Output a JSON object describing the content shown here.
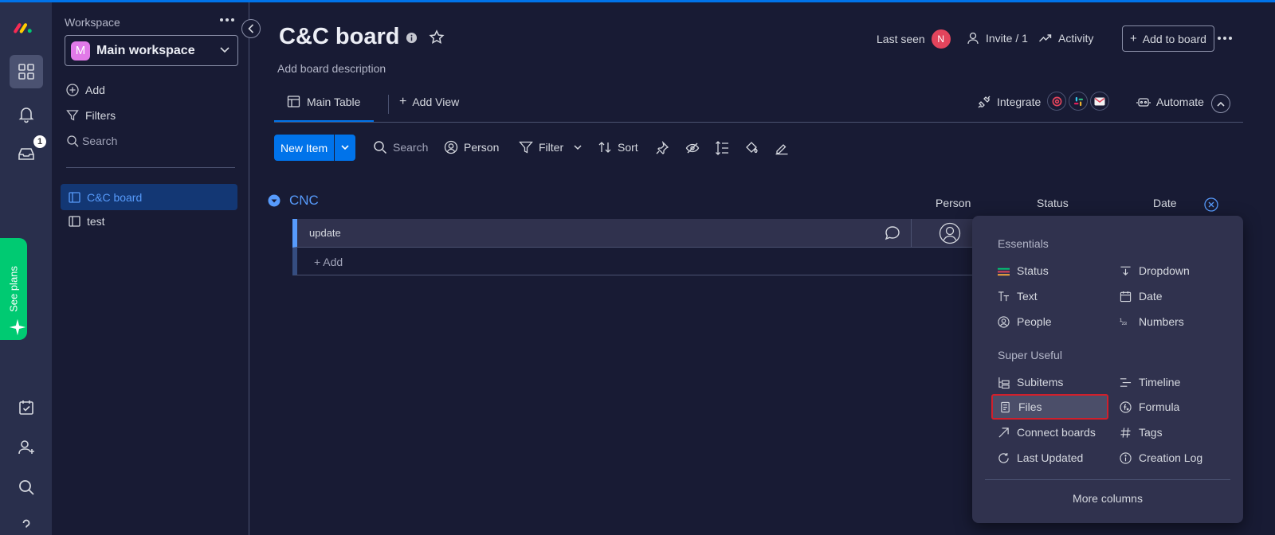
{
  "colors": {
    "accent": "#0073ea",
    "bg": "#181b34",
    "rail": "#292f4c",
    "green": "#00ca72",
    "avatar": "#e2445c"
  },
  "rail": {
    "inbox_badge": "1",
    "see_plans": "See plans"
  },
  "sidebar": {
    "workspace_label": "Workspace",
    "workspace_initial": "M",
    "workspace_name": "Main workspace",
    "add": "Add",
    "filters": "Filters",
    "search_placeholder": "Search",
    "boards": [
      {
        "label": "C&C board"
      },
      {
        "label": "test"
      }
    ]
  },
  "header": {
    "title": "C&C board",
    "description": "Add board description",
    "last_seen": "Last seen",
    "avatar_initial": "N",
    "invite": "Invite / 1",
    "activity": "Activity",
    "add_to_board": "Add to board"
  },
  "views": {
    "main_table": "Main Table",
    "add_view": "Add View",
    "integrate": "Integrate",
    "automate": "Automate"
  },
  "toolbar": {
    "new_item": "New Item",
    "search": "Search",
    "person": "Person",
    "filter": "Filter",
    "sort": "Sort"
  },
  "group": {
    "name": "CNC",
    "columns": {
      "person": "Person",
      "status": "Status",
      "date": "Date"
    },
    "rows": [
      {
        "name": "update"
      }
    ],
    "add_row": "+ Add"
  },
  "column_menu": {
    "essentials": "Essentials",
    "super_useful": "Super Useful",
    "items": {
      "status": "Status",
      "dropdown": "Dropdown",
      "text": "Text",
      "date": "Date",
      "people": "People",
      "numbers": "Numbers",
      "subitems": "Subitems",
      "timeline": "Timeline",
      "files": "Files",
      "formula": "Formula",
      "connect_boards": "Connect boards",
      "tags": "Tags",
      "last_updated": "Last Updated",
      "creation_log": "Creation Log"
    },
    "more": "More columns"
  }
}
